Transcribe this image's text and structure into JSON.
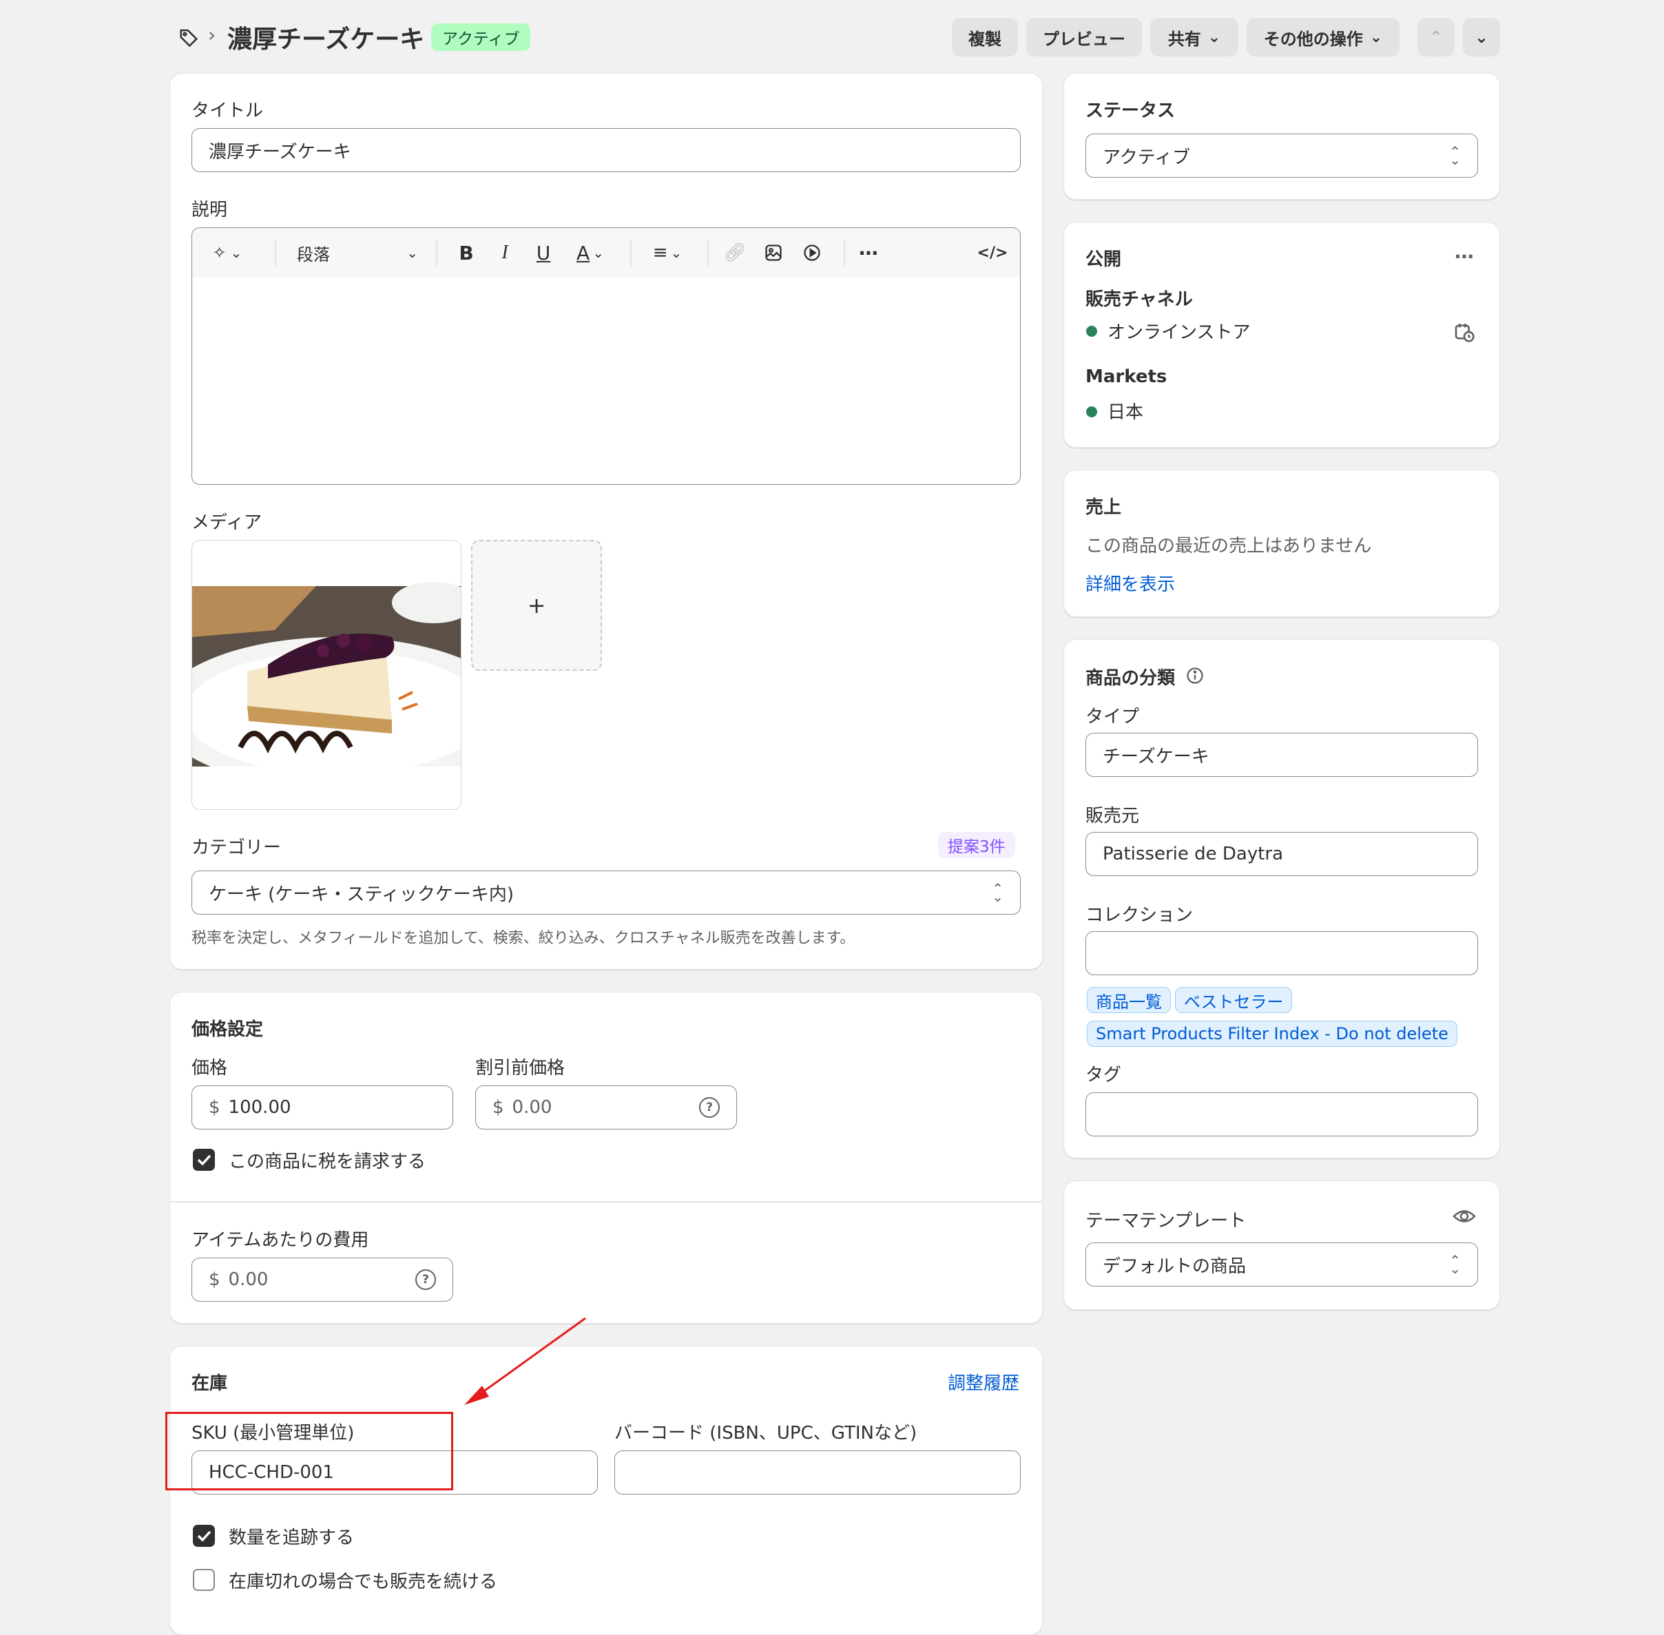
{
  "header": {
    "title": "濃厚チーズケーキ",
    "badge": "アクティブ",
    "duplicate": "複製",
    "preview": "プレビュー",
    "share": "共有",
    "more_actions": "その他の操作"
  },
  "main": {
    "title_label": "タイトル",
    "title_value": "濃厚チーズケーキ",
    "description_label": "説明",
    "paragraph_select": "段落",
    "media_label": "メディア",
    "add_media": "+",
    "category_label": "カテゴリー",
    "category_suggest": "提案3件",
    "category_value": "ケーキ (ケーキ・スティックケーキ内)",
    "category_help": "税率を決定し、メタフィールドを追加して、検索、絞り込み、クロスチャネル販売を改善します。"
  },
  "pricing": {
    "heading": "価格設定",
    "price_label": "価格",
    "price_currency": "$",
    "price_value": "100.00",
    "compare_label": "割引前価格",
    "compare_currency": "$",
    "compare_placeholder": "0.00",
    "charge_tax": "この商品に税を請求する",
    "cost_label": "アイテムあたりの費用",
    "cost_currency": "$",
    "cost_placeholder": "0.00"
  },
  "inventory": {
    "heading": "在庫",
    "history_link": "調整履歴",
    "sku_label": "SKU (最小管理単位)",
    "sku_value": "HCC-CHD-001",
    "barcode_label": "バーコード (ISBN、UPC、GTINなど)",
    "barcode_value": "",
    "track_quantity": "数量を追跡する",
    "continue_selling": "在庫切れの場合でも販売を続ける"
  },
  "status": {
    "heading": "ステータス",
    "value": "アクティブ"
  },
  "publishing": {
    "heading": "公開",
    "channels_label": "販売チャネル",
    "channel_online": "オンラインストア",
    "markets_label": "Markets",
    "market_japan": "日本"
  },
  "sales": {
    "heading": "売上",
    "empty_text": "この商品の最近の売上はありません",
    "details_link": "詳細を表示"
  },
  "organization": {
    "heading": "商品の分類",
    "type_label": "タイプ",
    "type_value": "チーズケーキ",
    "vendor_label": "販売元",
    "vendor_value": "Patisserie de Daytra",
    "collections_label": "コレクション",
    "collections": [
      "商品一覧",
      "ベストセラー",
      "Smart Products Filter Index - Do not delete"
    ],
    "tags_label": "タグ"
  },
  "theme": {
    "heading": "テーマテンプレート",
    "value": "デフォルトの商品"
  },
  "colors": {
    "accent": "#005bd3",
    "success": "#29845a",
    "badge_bg": "#affebf",
    "annotation": "#e51c1c"
  }
}
